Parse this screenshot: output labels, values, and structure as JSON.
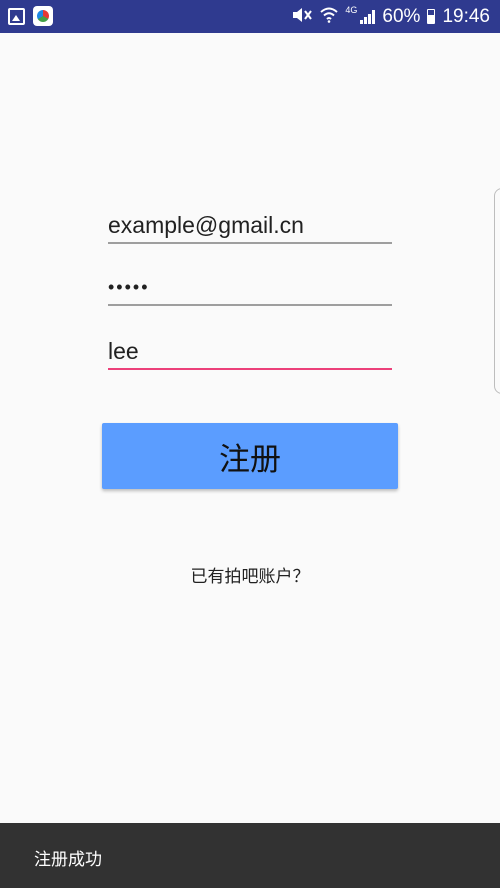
{
  "status_bar": {
    "left_icons": [
      "gallery-notification-icon",
      "app-notification-icon"
    ],
    "network_type": "4G",
    "battery_percent": "60%",
    "time": "19:46",
    "background_color": "#2f3a8f"
  },
  "form": {
    "email_value": "example@gmail.cn",
    "password_value": "•••••",
    "name_value": "lee",
    "focused_field": "name",
    "focus_color": "#ec407a"
  },
  "register_button": {
    "label": "注册",
    "color": "#5b9dff"
  },
  "login_link": {
    "label": "已有拍吧账户？"
  },
  "snackbar": {
    "message": "注册成功"
  }
}
